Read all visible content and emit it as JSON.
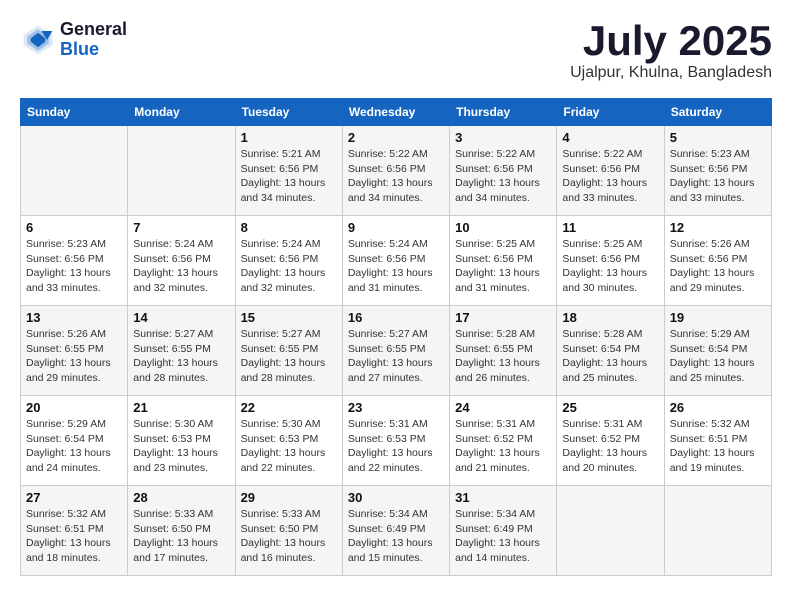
{
  "logo": {
    "line1": "General",
    "line2": "Blue"
  },
  "title": "July 2025",
  "location": "Ujalpur, Khulna, Bangladesh",
  "headers": [
    "Sunday",
    "Monday",
    "Tuesday",
    "Wednesday",
    "Thursday",
    "Friday",
    "Saturday"
  ],
  "weeks": [
    [
      {
        "day": "",
        "sunrise": "",
        "sunset": "",
        "daylight": ""
      },
      {
        "day": "",
        "sunrise": "",
        "sunset": "",
        "daylight": ""
      },
      {
        "day": "1",
        "sunrise": "Sunrise: 5:21 AM",
        "sunset": "Sunset: 6:56 PM",
        "daylight": "Daylight: 13 hours and 34 minutes."
      },
      {
        "day": "2",
        "sunrise": "Sunrise: 5:22 AM",
        "sunset": "Sunset: 6:56 PM",
        "daylight": "Daylight: 13 hours and 34 minutes."
      },
      {
        "day": "3",
        "sunrise": "Sunrise: 5:22 AM",
        "sunset": "Sunset: 6:56 PM",
        "daylight": "Daylight: 13 hours and 34 minutes."
      },
      {
        "day": "4",
        "sunrise": "Sunrise: 5:22 AM",
        "sunset": "Sunset: 6:56 PM",
        "daylight": "Daylight: 13 hours and 33 minutes."
      },
      {
        "day": "5",
        "sunrise": "Sunrise: 5:23 AM",
        "sunset": "Sunset: 6:56 PM",
        "daylight": "Daylight: 13 hours and 33 minutes."
      }
    ],
    [
      {
        "day": "6",
        "sunrise": "Sunrise: 5:23 AM",
        "sunset": "Sunset: 6:56 PM",
        "daylight": "Daylight: 13 hours and 33 minutes."
      },
      {
        "day": "7",
        "sunrise": "Sunrise: 5:24 AM",
        "sunset": "Sunset: 6:56 PM",
        "daylight": "Daylight: 13 hours and 32 minutes."
      },
      {
        "day": "8",
        "sunrise": "Sunrise: 5:24 AM",
        "sunset": "Sunset: 6:56 PM",
        "daylight": "Daylight: 13 hours and 32 minutes."
      },
      {
        "day": "9",
        "sunrise": "Sunrise: 5:24 AM",
        "sunset": "Sunset: 6:56 PM",
        "daylight": "Daylight: 13 hours and 31 minutes."
      },
      {
        "day": "10",
        "sunrise": "Sunrise: 5:25 AM",
        "sunset": "Sunset: 6:56 PM",
        "daylight": "Daylight: 13 hours and 31 minutes."
      },
      {
        "day": "11",
        "sunrise": "Sunrise: 5:25 AM",
        "sunset": "Sunset: 6:56 PM",
        "daylight": "Daylight: 13 hours and 30 minutes."
      },
      {
        "day": "12",
        "sunrise": "Sunrise: 5:26 AM",
        "sunset": "Sunset: 6:56 PM",
        "daylight": "Daylight: 13 hours and 29 minutes."
      }
    ],
    [
      {
        "day": "13",
        "sunrise": "Sunrise: 5:26 AM",
        "sunset": "Sunset: 6:55 PM",
        "daylight": "Daylight: 13 hours and 29 minutes."
      },
      {
        "day": "14",
        "sunrise": "Sunrise: 5:27 AM",
        "sunset": "Sunset: 6:55 PM",
        "daylight": "Daylight: 13 hours and 28 minutes."
      },
      {
        "day": "15",
        "sunrise": "Sunrise: 5:27 AM",
        "sunset": "Sunset: 6:55 PM",
        "daylight": "Daylight: 13 hours and 28 minutes."
      },
      {
        "day": "16",
        "sunrise": "Sunrise: 5:27 AM",
        "sunset": "Sunset: 6:55 PM",
        "daylight": "Daylight: 13 hours and 27 minutes."
      },
      {
        "day": "17",
        "sunrise": "Sunrise: 5:28 AM",
        "sunset": "Sunset: 6:55 PM",
        "daylight": "Daylight: 13 hours and 26 minutes."
      },
      {
        "day": "18",
        "sunrise": "Sunrise: 5:28 AM",
        "sunset": "Sunset: 6:54 PM",
        "daylight": "Daylight: 13 hours and 25 minutes."
      },
      {
        "day": "19",
        "sunrise": "Sunrise: 5:29 AM",
        "sunset": "Sunset: 6:54 PM",
        "daylight": "Daylight: 13 hours and 25 minutes."
      }
    ],
    [
      {
        "day": "20",
        "sunrise": "Sunrise: 5:29 AM",
        "sunset": "Sunset: 6:54 PM",
        "daylight": "Daylight: 13 hours and 24 minutes."
      },
      {
        "day": "21",
        "sunrise": "Sunrise: 5:30 AM",
        "sunset": "Sunset: 6:53 PM",
        "daylight": "Daylight: 13 hours and 23 minutes."
      },
      {
        "day": "22",
        "sunrise": "Sunrise: 5:30 AM",
        "sunset": "Sunset: 6:53 PM",
        "daylight": "Daylight: 13 hours and 22 minutes."
      },
      {
        "day": "23",
        "sunrise": "Sunrise: 5:31 AM",
        "sunset": "Sunset: 6:53 PM",
        "daylight": "Daylight: 13 hours and 22 minutes."
      },
      {
        "day": "24",
        "sunrise": "Sunrise: 5:31 AM",
        "sunset": "Sunset: 6:52 PM",
        "daylight": "Daylight: 13 hours and 21 minutes."
      },
      {
        "day": "25",
        "sunrise": "Sunrise: 5:31 AM",
        "sunset": "Sunset: 6:52 PM",
        "daylight": "Daylight: 13 hours and 20 minutes."
      },
      {
        "day": "26",
        "sunrise": "Sunrise: 5:32 AM",
        "sunset": "Sunset: 6:51 PM",
        "daylight": "Daylight: 13 hours and 19 minutes."
      }
    ],
    [
      {
        "day": "27",
        "sunrise": "Sunrise: 5:32 AM",
        "sunset": "Sunset: 6:51 PM",
        "daylight": "Daylight: 13 hours and 18 minutes."
      },
      {
        "day": "28",
        "sunrise": "Sunrise: 5:33 AM",
        "sunset": "Sunset: 6:50 PM",
        "daylight": "Daylight: 13 hours and 17 minutes."
      },
      {
        "day": "29",
        "sunrise": "Sunrise: 5:33 AM",
        "sunset": "Sunset: 6:50 PM",
        "daylight": "Daylight: 13 hours and 16 minutes."
      },
      {
        "day": "30",
        "sunrise": "Sunrise: 5:34 AM",
        "sunset": "Sunset: 6:49 PM",
        "daylight": "Daylight: 13 hours and 15 minutes."
      },
      {
        "day": "31",
        "sunrise": "Sunrise: 5:34 AM",
        "sunset": "Sunset: 6:49 PM",
        "daylight": "Daylight: 13 hours and 14 minutes."
      },
      {
        "day": "",
        "sunrise": "",
        "sunset": "",
        "daylight": ""
      },
      {
        "day": "",
        "sunrise": "",
        "sunset": "",
        "daylight": ""
      }
    ]
  ]
}
